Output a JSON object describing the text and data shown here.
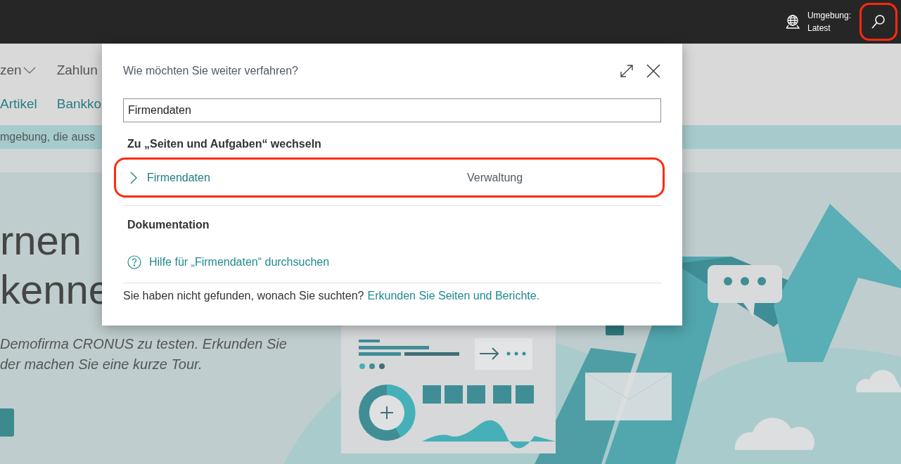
{
  "top_bar": {
    "environment_label": "Umgebung:",
    "environment_value": "Latest",
    "search_highlighted": true
  },
  "nav": {
    "menu_items": [
      {
        "label": "zen",
        "kind": "dropdown"
      },
      {
        "label": "Zahlun",
        "kind": "plain"
      }
    ],
    "links": [
      "Artikel",
      "Bankko"
    ]
  },
  "notice": "mgebung, die auss",
  "hero": {
    "title_lines": [
      "rnen",
      "kenne"
    ],
    "text_lines": [
      "Demofirma CRONUS zu testen. Erkunden Sie",
      "der machen Sie eine kurze Tour."
    ]
  },
  "dialog": {
    "title": "Wie möchten Sie weiter verfahren?",
    "search": {
      "value": "Firmendaten"
    },
    "pages_heading": "Zu „Seiten und Aufgaben“ wechseln",
    "results": [
      {
        "name": "Firmendaten",
        "category": "Verwaltung",
        "highlighted": true
      }
    ],
    "docs_heading": "Dokumentation",
    "help_link": "Hilfe für „Firmendaten“ durchsuchen",
    "footer_text": "Sie haben nicht gefunden, wonach Sie suchten?",
    "footer_link": "Erkunden Sie Seiten und Berichte."
  }
}
